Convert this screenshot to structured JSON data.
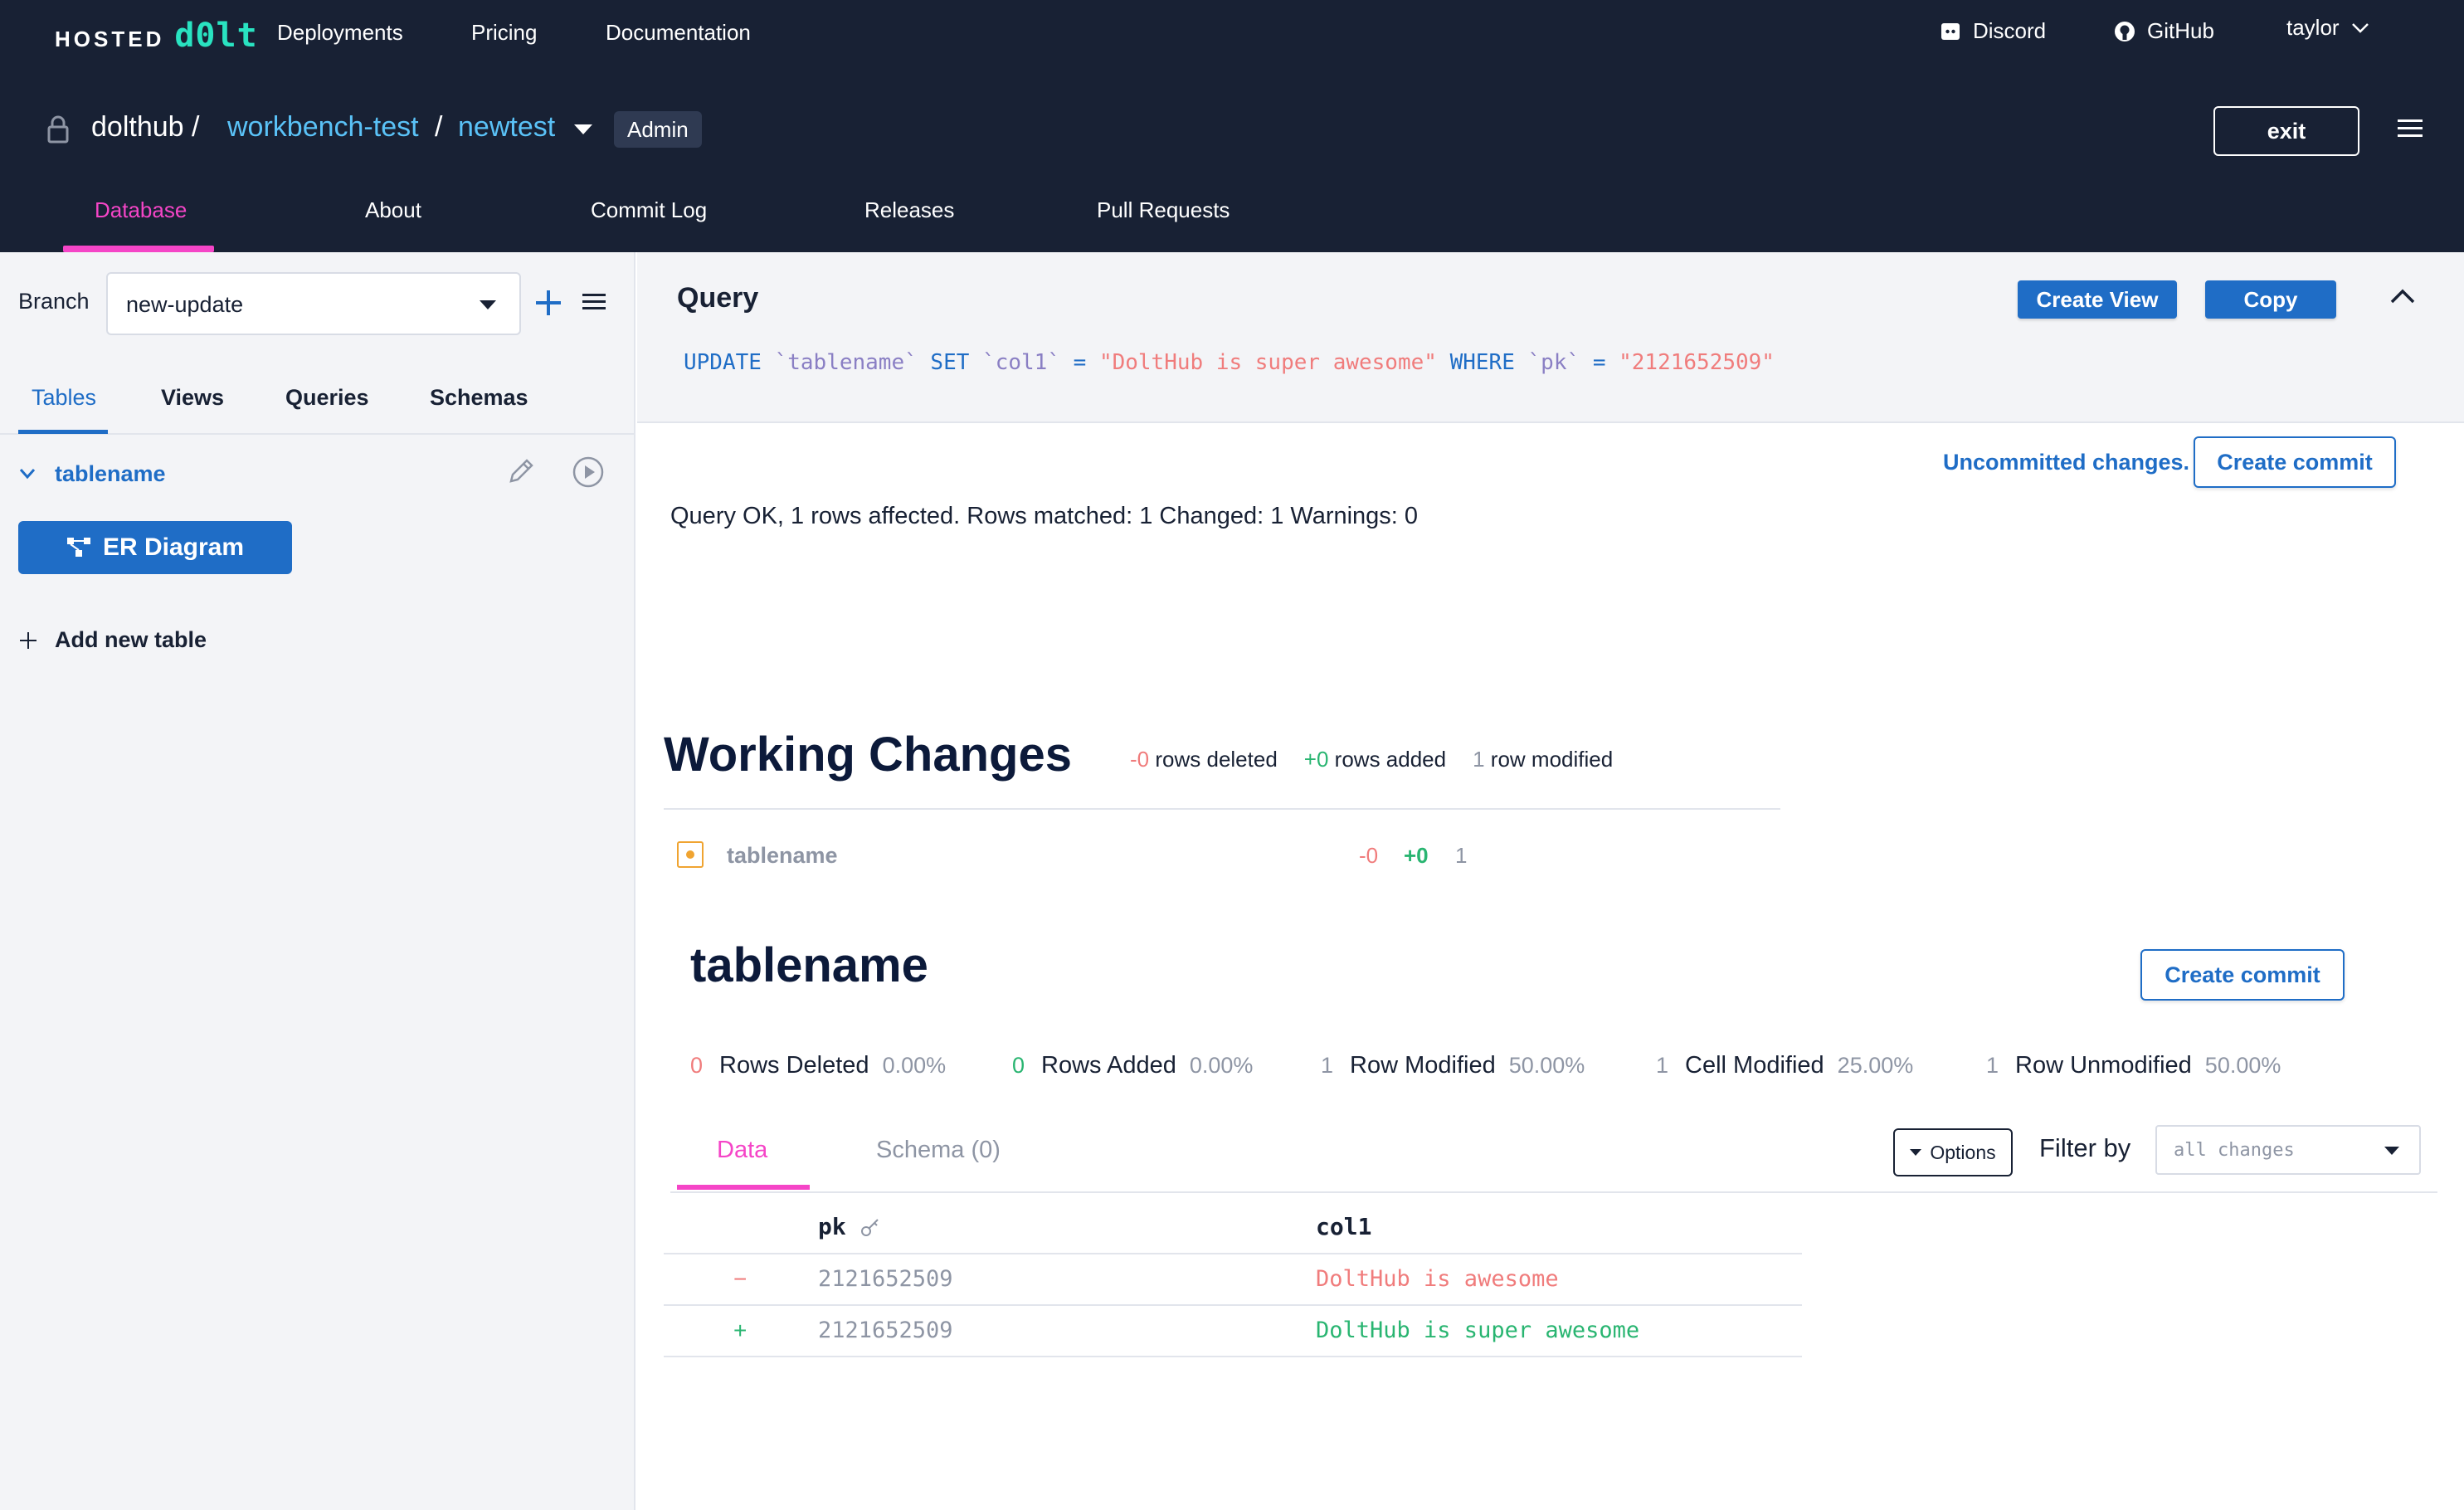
{
  "header": {
    "logo_hosted": "HOSTED",
    "logo_dolt": "d0lt",
    "nav": [
      "Deployments",
      "Pricing",
      "Documentation"
    ],
    "discord_label": "Discord",
    "github_label": "GitHub",
    "user": "taylor"
  },
  "repo": {
    "owner": "dolthub /",
    "name": "workbench-test",
    "separator": "/",
    "database": "newtest",
    "badge": "Admin",
    "exit_label": "exit"
  },
  "tabs": [
    "Database",
    "About",
    "Commit Log",
    "Releases",
    "Pull Requests"
  ],
  "sidebar": {
    "branch_label": "Branch",
    "branch_value": "new-update",
    "tabs": [
      "Tables",
      "Views",
      "Queries",
      "Schemas"
    ],
    "table_name": "tablename",
    "er_button": "ER Diagram",
    "add_table": "Add new table"
  },
  "query": {
    "title": "Query",
    "create_view": "Create View",
    "copy": "Copy",
    "sql": {
      "k1": "UPDATE",
      "t1": "`tablename`",
      "k2": "SET",
      "c1": "`col1`",
      "eq1": "=",
      "s1": "\"DoltHub is super awesome\"",
      "k3": "WHERE",
      "c2": "`pk`",
      "eq2": "=",
      "s2": "\"2121652509\""
    }
  },
  "result": {
    "uncommitted": "Uncommitted changes.",
    "create_commit": "Create commit",
    "message": "Query OK, 1 rows affected. Rows matched: 1 Changed: 1 Warnings: 0"
  },
  "working_changes": {
    "title": "Working Changes",
    "deleted_num": "-0",
    "deleted_label": "rows deleted",
    "added_num": "+0",
    "added_label": "rows added",
    "modified_num": "1",
    "modified_label": "row modified",
    "row": {
      "name": "tablename",
      "deleted": "-0",
      "added": "+0",
      "modified": "1"
    }
  },
  "table_diff": {
    "title": "tablename",
    "create_commit": "Create commit",
    "summary": [
      {
        "num": "0",
        "label": "Rows Deleted",
        "pct": "0.00%"
      },
      {
        "num": "0",
        "label": "Rows Added",
        "pct": "0.00%"
      },
      {
        "num": "1",
        "label": "Row Modified",
        "pct": "50.00%"
      },
      {
        "num": "1",
        "label": "Cell Modified",
        "pct": "25.00%"
      },
      {
        "num": "1",
        "label": "Row Unmodified",
        "pct": "50.00%"
      }
    ],
    "tabs": {
      "data": "Data",
      "schema": "Schema (0)"
    },
    "options_label": "Options",
    "filter_label": "Filter by",
    "filter_placeholder": "all changes",
    "columns": [
      "pk",
      "col1"
    ],
    "rows": [
      {
        "sign": "−",
        "pk": "2121652509",
        "col1": "DoltHub is awesome"
      },
      {
        "sign": "+",
        "pk": "2121652509",
        "col1": "DoltHub is super awesome"
      }
    ]
  },
  "colors": {
    "header_bg": "#182134",
    "accent_pink": "#f545c7",
    "link_blue": "#1f6dc6",
    "removed_red": "#f07c7c",
    "added_green": "#29b571",
    "logo_teal": "#29e3c1"
  }
}
